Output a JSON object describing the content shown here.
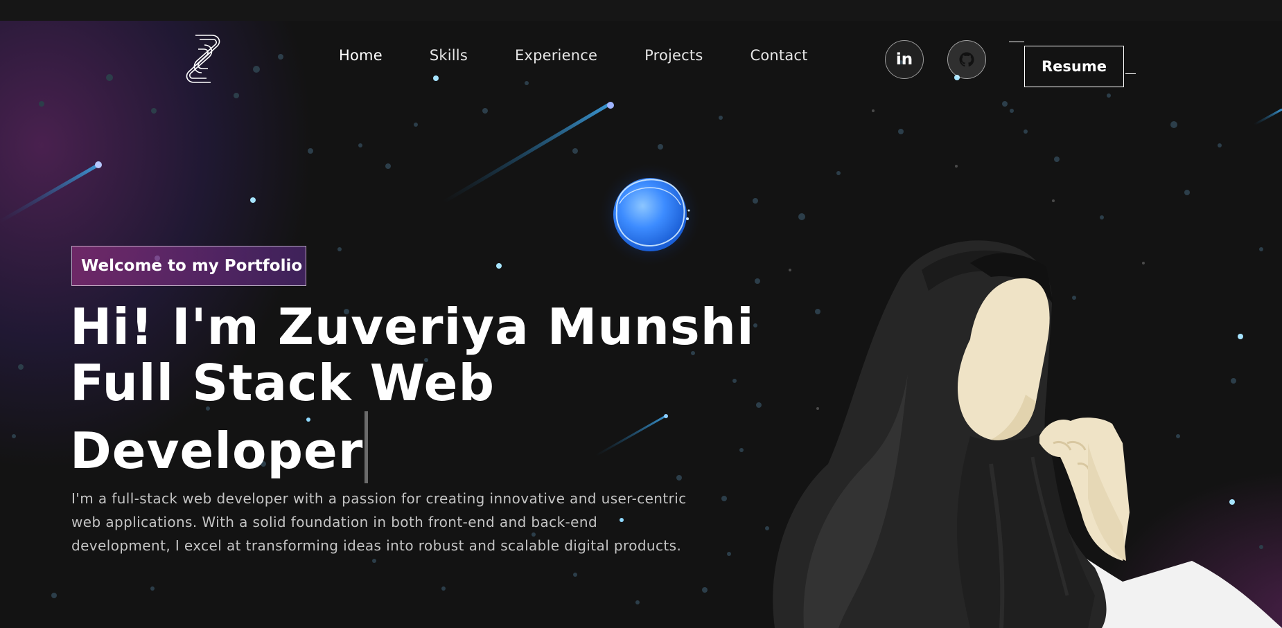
{
  "nav": {
    "links": [
      {
        "label": "Home"
      },
      {
        "label": "Skills"
      },
      {
        "label": "Experience"
      },
      {
        "label": "Projects"
      },
      {
        "label": "Contact"
      }
    ],
    "social": [
      {
        "name": "LinkedIn",
        "glyph": "in",
        "icon": "linkedin-icon"
      },
      {
        "name": "GitHub",
        "icon": "github-icon"
      }
    ],
    "resume_label": "Resume"
  },
  "hero": {
    "badge": "Welcome to my Portfolio",
    "headline_line1": "Hi! I'm Zuveriya Munshi",
    "headline_line2": "Full Stack Web",
    "headline_line3": "Developer",
    "intro": "I'm a full-stack web developer with a passion for creating innovative and user-centric web applications. With a solid foundation in both front-end and back-end development, I excel at transforming ideas into robust and scalable digital products."
  },
  "colors": {
    "background": "#121212",
    "accent_purple": "#782a6e",
    "orb_blue": "#3b8cff",
    "text_muted": "#c4c4c4"
  },
  "icons": [
    "logo-icon",
    "linkedin-icon",
    "github-icon",
    "planet-orb-icon",
    "hijab-character-illustration"
  ]
}
